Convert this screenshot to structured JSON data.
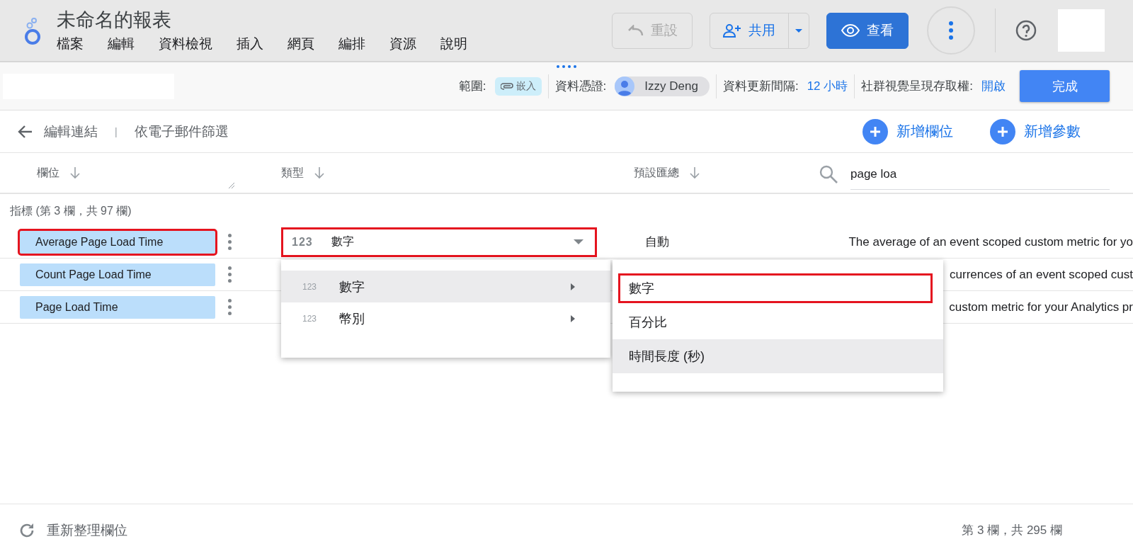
{
  "header": {
    "title": "未命名的報表",
    "menu": [
      "檔案",
      "編輯",
      "資料檢視",
      "插入",
      "網頁",
      "編排",
      "資源",
      "說明"
    ],
    "reset_button": {
      "label": "重設",
      "disabled": true
    },
    "share_button": "共用",
    "view_button": "查看"
  },
  "toolbar": {
    "scope_label": "範圍:",
    "scope_chip": "嵌入",
    "credentials_label": "資料憑證:",
    "credentials_user": "Izzy Deng",
    "freshness_label": "資料更新間隔:",
    "freshness_value": "12 小時",
    "access_label": "社群視覺呈現存取權:",
    "access_value": "開啟",
    "done_button": "完成"
  },
  "breadcrumb": {
    "items": [
      "編輯連結",
      "依電子郵件篩選"
    ],
    "separator": "|"
  },
  "actions": [
    "新增欄位",
    "新增參數"
  ],
  "columns": [
    "欄位",
    "類型",
    "預設匯總"
  ],
  "search": {
    "value": "page loa"
  },
  "group_label": "指標 (第 3 欄，共 97 欄)",
  "rows": [
    {
      "name": "Average Page Load Time",
      "highlighted": true,
      "type_icon": "123",
      "type": "數字",
      "aggregation": "自動",
      "description": "The average of an event scoped custom metric for yo"
    },
    {
      "name": "Count Page Load Time",
      "highlighted": false,
      "description": "currences of an event scoped cust"
    },
    {
      "name": "Page Load Time",
      "highlighted": false,
      "description": "custom metric for your Analytics pr"
    }
  ],
  "type_menu": {
    "items": [
      {
        "icon_text": "123",
        "label": "數字",
        "hovered": true
      },
      {
        "icon_text": "123",
        "label": "幣別",
        "hovered": false
      }
    ]
  },
  "submenu": {
    "items": [
      {
        "label": "數字",
        "highlighted": true,
        "hovered": false
      },
      {
        "label": "百分比",
        "highlighted": false,
        "hovered": false
      },
      {
        "label": "時間長度 (秒)",
        "highlighted": false,
        "hovered": true
      }
    ]
  },
  "footer": {
    "refresh": "重新整理欄位",
    "count": "第 3 欄，共 295 欄"
  }
}
